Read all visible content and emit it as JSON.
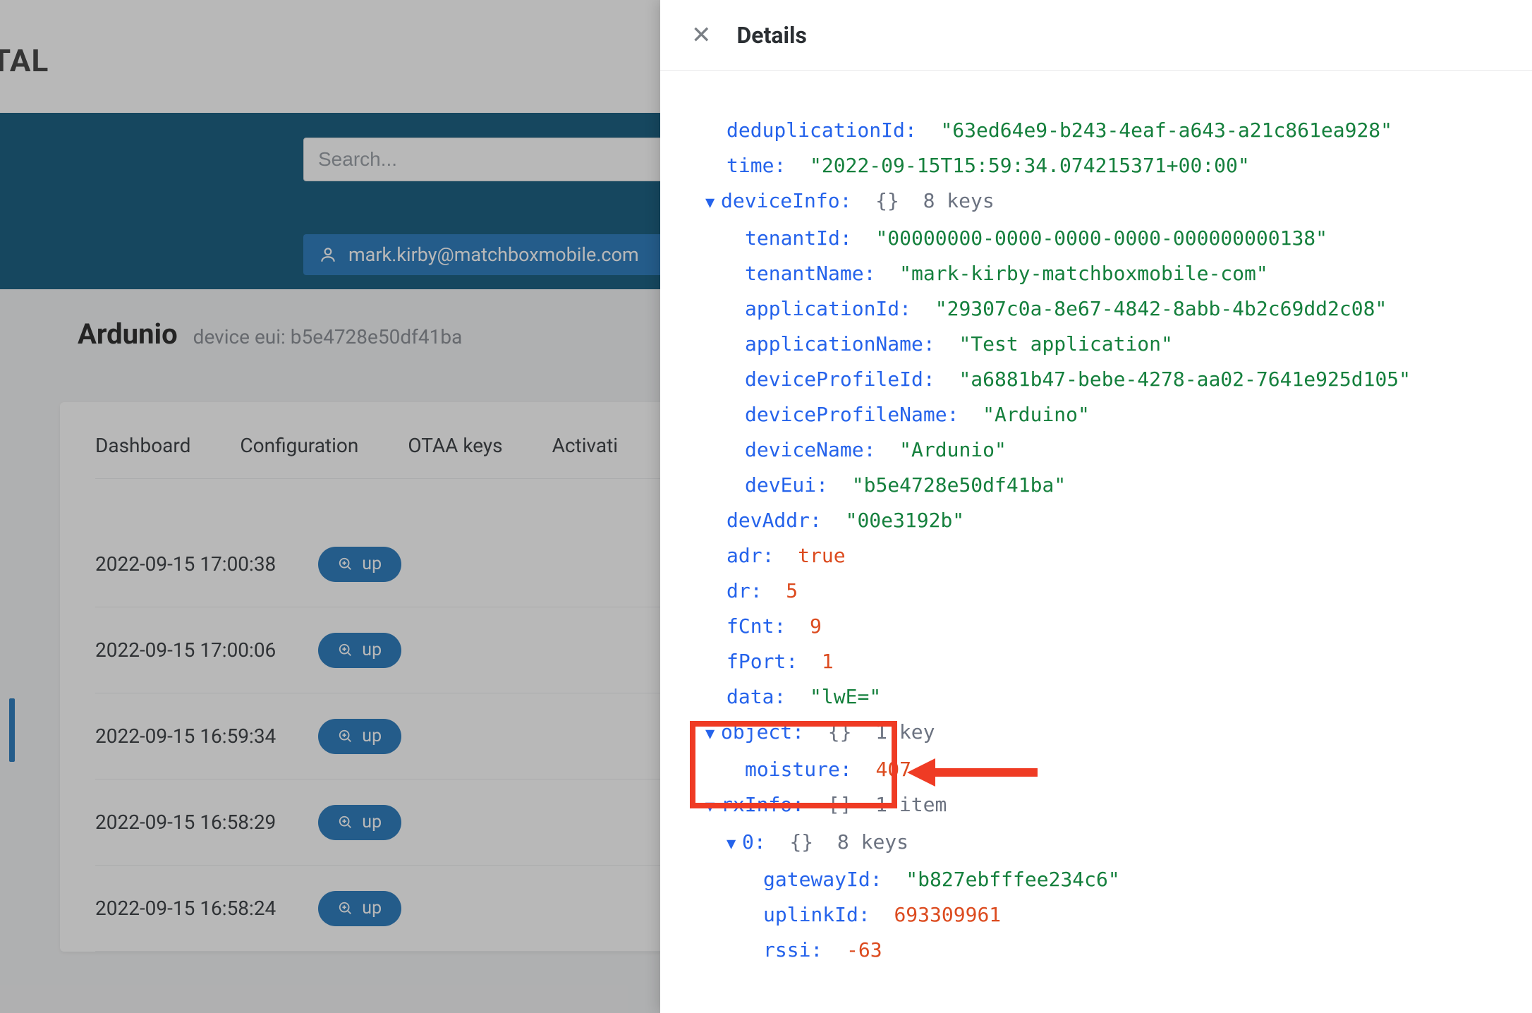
{
  "topbar": {
    "portal": "RTAL"
  },
  "search": {
    "placeholder": "Search..."
  },
  "user": {
    "email": "mark.kirby@matchboxmobile.com"
  },
  "device": {
    "name": "Ardunio",
    "eui_label": "device eui: b5e4728e50df41ba"
  },
  "tabs": {
    "dashboard": "Dashboard",
    "configuration": "Configuration",
    "otaa": "OTAA keys",
    "activation": "Activati"
  },
  "events": [
    {
      "ts": "2022-09-15 17:00:38",
      "dir": "up"
    },
    {
      "ts": "2022-09-15 17:00:06",
      "dir": "up"
    },
    {
      "ts": "2022-09-15 16:59:34",
      "dir": "up"
    },
    {
      "ts": "2022-09-15 16:58:29",
      "dir": "up"
    },
    {
      "ts": "2022-09-15 16:58:24",
      "dir": "up"
    }
  ],
  "details": {
    "title": "Details",
    "json": {
      "deduplicationId": "63ed64e9-b243-4eaf-a643-a21c861ea928",
      "time": "2022-09-15T15:59:34.074215371+00:00",
      "deviceInfo_meta": "8 keys",
      "deviceInfo": {
        "tenantId": "00000000-0000-0000-0000-000000000138",
        "tenantName": "mark-kirby-matchboxmobile-com",
        "applicationId": "29307c0a-8e67-4842-8abb-4b2c69dd2c08",
        "applicationName": "Test application",
        "deviceProfileId": "a6881b47-bebe-4278-aa02-7641e925d105",
        "deviceProfileName": "Arduino",
        "deviceName": "Ardunio",
        "devEui": "b5e4728e50df41ba"
      },
      "devAddr": "00e3192b",
      "adr": "true",
      "dr": "5",
      "fCnt": "9",
      "fPort": "1",
      "data": "lwE=",
      "object_meta": "1 key",
      "object": {
        "moisture": "407"
      },
      "rxInfo_meta": "1 item",
      "rxInfo0_meta": "8 keys",
      "rxInfo0": {
        "gatewayId": "b827ebfffee234c6",
        "uplinkId": "693309961",
        "rssi": "-63"
      }
    }
  }
}
